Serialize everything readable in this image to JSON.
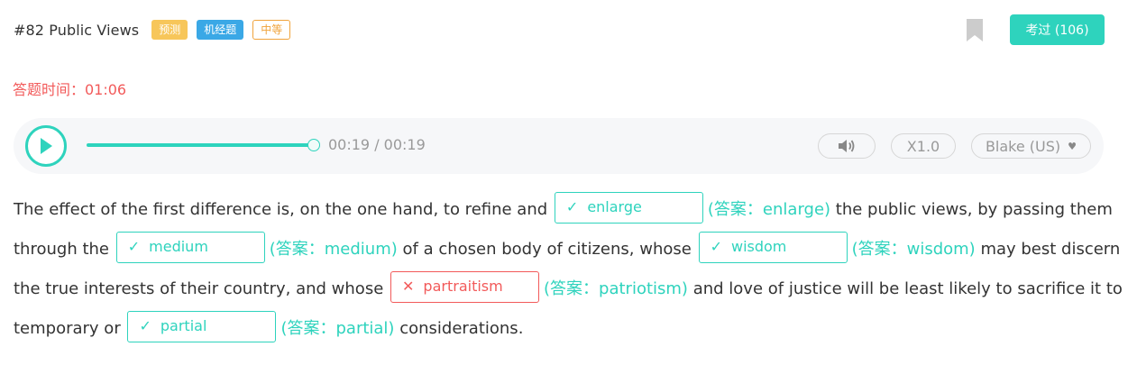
{
  "header": {
    "title": "#82 Public Views",
    "tags": {
      "forecast": "预测",
      "machine": "机经题",
      "level": "中等"
    },
    "exam_button": "考过 (106)"
  },
  "timer": "答题时间：01:06",
  "player": {
    "time": "00:19 / 00:19",
    "progress": 1.0,
    "speed": "X1.0",
    "voice": "Blake (US)"
  },
  "passage": {
    "t1": "The effect of the first difference is, on the one hand, to refine and",
    "b1": {
      "mark": "✓",
      "value": "enlarge",
      "answer": "(答案：enlarge)",
      "correct": true
    },
    "t2": "the public views, by passing them through the",
    "b2": {
      "mark": "✓",
      "value": "medium",
      "answer": "(答案：medium)",
      "correct": true
    },
    "t3": "of a chosen body of citizens, whose",
    "b3": {
      "mark": "✓",
      "value": "wisdom",
      "answer": "(答案：wisdom)",
      "correct": true
    },
    "t4": "may best discern the true interests of their country, and whose",
    "b4": {
      "mark": "✕",
      "value": "partraitism",
      "answer": "(答案：patriotism)",
      "correct": false
    },
    "t5": "and love of justice will be least likely to sacrifice it to temporary or",
    "b5": {
      "mark": "✓",
      "value": "partial",
      "answer": "(答案：partial)",
      "correct": true
    },
    "t6": "considerations."
  },
  "colors": {
    "accent": "#2ed3bd",
    "error": "#f25a5a",
    "tag_forecast": "#f7c65a",
    "tag_machine": "#3aa8e6",
    "tag_level": "#f0a33b"
  }
}
